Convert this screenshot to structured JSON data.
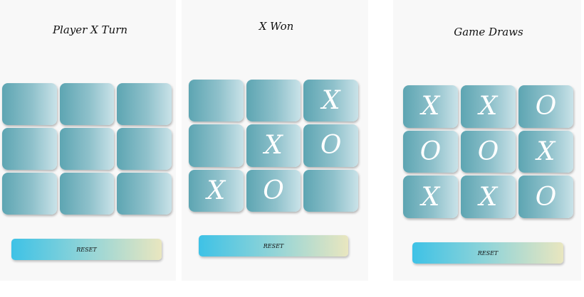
{
  "screens": [
    {
      "status": "Player X Turn",
      "board": [
        "",
        "",
        "",
        "",
        "",
        "",
        "",
        "",
        ""
      ],
      "reset_label": "RESET"
    },
    {
      "status": "X Won",
      "board": [
        "",
        "",
        "X",
        "",
        "X",
        "O",
        "X",
        "O",
        ""
      ],
      "reset_label": "RESET"
    },
    {
      "status": "Game Draws",
      "board": [
        "X",
        "X",
        "O",
        "O",
        "O",
        "X",
        "X",
        "X",
        "O"
      ],
      "reset_label": "RESET"
    }
  ],
  "colors": {
    "tile_dark": "#5da5b2",
    "tile_light": "#c9e2e8",
    "button_start": "#3ec2e6",
    "button_end": "#e9e6bf",
    "mark": "#ffffff",
    "panel_bg": "#f8f8f8"
  }
}
